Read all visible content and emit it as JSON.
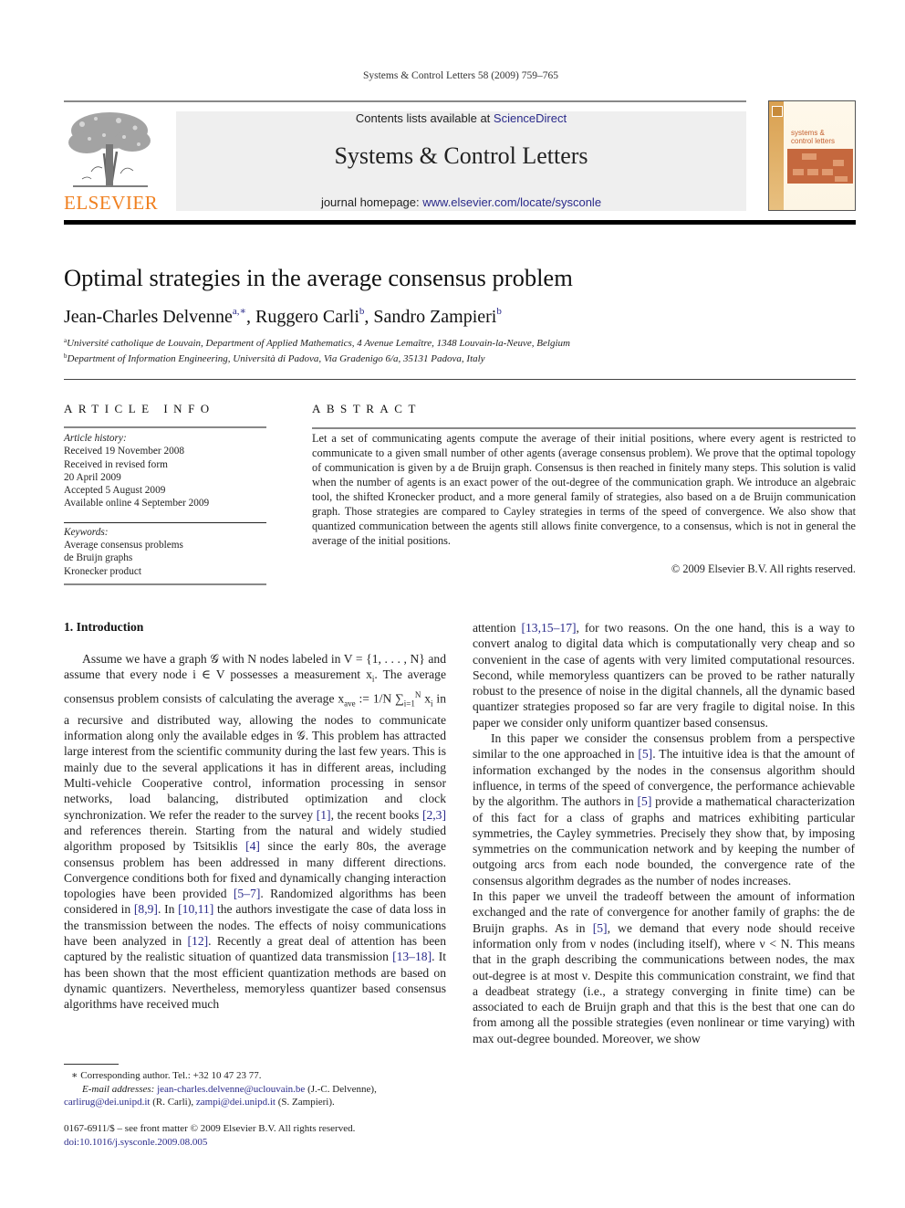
{
  "header": {
    "journal_reference": "Systems & Control Letters 58 (2009) 759–765",
    "publisher_logo_text": "ELSEVIER",
    "contents_prefix": "Contents lists available at ",
    "contents_link": "ScienceDirect",
    "journal_title": "Systems & Control Letters",
    "homepage_prefix": "journal homepage: ",
    "homepage_link": "www.elsevier.com/locate/sysconle",
    "cover_title_line1": "systems &",
    "cover_title_line2": "control letters",
    "colors": {
      "publisher_orange": "#f08020",
      "link_blue": "#2a2a8a",
      "cover_accent": "#c5683e"
    }
  },
  "article": {
    "title": "Optimal strategies in the average consensus problem",
    "authors": [
      {
        "name": "Jean-Charles Delvenne",
        "marks": "a,∗",
        "sep": ", "
      },
      {
        "name": "Ruggero Carli",
        "marks": "b",
        "sep": ", "
      },
      {
        "name": "Sandro Zampieri",
        "marks": "b",
        "sep": ""
      }
    ],
    "affiliations": [
      {
        "mark": "a",
        "text": "Université catholique de Louvain, Department of Applied Mathematics, 4 Avenue Lemaître, 1348 Louvain-la-Neuve, Belgium"
      },
      {
        "mark": "b",
        "text": "Department of Information Engineering, Università di Padova, Via Gradenigo 6/a, 35131 Padova, Italy"
      }
    ]
  },
  "article_info": {
    "heading": "ARTICLE INFO",
    "history_label": "Article history:",
    "history": [
      "Received 19 November 2008",
      "Received in revised form",
      "20 April 2009",
      "Accepted 5 August 2009",
      "Available online 4 September 2009"
    ],
    "keywords_label": "Keywords:",
    "keywords": [
      "Average consensus problems",
      "de Bruijn graphs",
      "Kronecker product"
    ]
  },
  "abstract": {
    "heading": "ABSTRACT",
    "text": "Let a set of communicating agents compute the average of their initial positions, where every agent is restricted to communicate to a given small number of other agents (average consensus problem). We prove that the optimal topology of communication is given by a de Bruijn graph. Consensus is then reached in finitely many steps. This solution is valid when the number of agents is an exact power of the out-degree of the communication graph. We introduce an algebraic tool, the shifted Kronecker product, and a more general family of strategies, also based on a de Bruijn communication graph. Those strategies are compared to Cayley strategies in terms of the speed of convergence. We also show that quantized communication between the agents still allows finite convergence, to a consensus, which is not in general the average of the initial positions.",
    "copyright": "© 2009 Elsevier B.V. All rights reserved."
  },
  "body": {
    "section_title": "1. Introduction",
    "left_paragraph": [
      {
        "t": "Assume we have a graph 𝒢 with N nodes labeled in V = {1, . . . , N} and assume that every node i ∈ V possesses a measurement x"
      },
      {
        "t": "i",
        "sub": true
      },
      {
        "t": ". The average consensus problem consists of calculating the average x"
      },
      {
        "t": "ave",
        "sub": true
      },
      {
        "t": " := 1/N ∑"
      },
      {
        "t": "i=1",
        "sub": true
      },
      {
        "t": "N",
        "sup": true
      },
      {
        "t": " x"
      },
      {
        "t": "i",
        "sub": true
      },
      {
        "t": " in a recursive and distributed way, allowing the nodes to communicate information along only the available edges in 𝒢. This problem has attracted large interest from the scientific community during the last few years. This is mainly due to the several applications it has in different areas, including Multi-vehicle Cooperative control, information processing in sensor networks, load balancing, distributed optimization and clock synchronization. We refer the reader to the survey "
      },
      {
        "t": "[1]",
        "link": true
      },
      {
        "t": ", the recent books "
      },
      {
        "t": "[2,3]",
        "link": true
      },
      {
        "t": " and references therein. Starting from the natural and widely studied algorithm proposed by Tsitsiklis "
      },
      {
        "t": "[4]",
        "link": true
      },
      {
        "t": " since the early 80s, the average consensus problem has been addressed in many different directions. Convergence conditions both for fixed and dynamically changing interaction topologies have been provided "
      },
      {
        "t": "[5–7]",
        "link": true
      },
      {
        "t": ". Randomized algorithms has been considered in "
      },
      {
        "t": "[8,9]",
        "link": true
      },
      {
        "t": ". In "
      },
      {
        "t": "[10,11]",
        "link": true
      },
      {
        "t": " the authors investigate the case of data loss in the transmission between the nodes. The effects of noisy communications have been analyzed in "
      },
      {
        "t": "[12]",
        "link": true
      },
      {
        "t": ". Recently a great deal of attention has been captured by the realistic situation of quantized data transmission "
      },
      {
        "t": "[13–18]",
        "link": true
      },
      {
        "t": ". It has been shown that the most efficient quantization methods are based on dynamic quantizers. Nevertheless, memoryless quantizer based consensus algorithms have received much"
      }
    ],
    "right_paragraphs": [
      {
        "indent": false,
        "parts": [
          {
            "t": "attention "
          },
          {
            "t": "[13,15–17]",
            "link": true
          },
          {
            "t": ", for two reasons. On the one hand, this is a way to convert analog to digital data which is computationally very cheap and so convenient in the case of agents with very limited computational resources. Second, while memoryless quantizers can be proved to be rather naturally robust to the presence of noise in the digital channels, all the dynamic based quantizer strategies proposed so far are very fragile to digital noise. In this paper we consider only uniform quantizer based consensus."
          }
        ]
      },
      {
        "indent": true,
        "parts": [
          {
            "t": "In this paper we consider the consensus problem from a perspective similar to the one approached in "
          },
          {
            "t": "[5]",
            "link": true
          },
          {
            "t": ". The intuitive idea is that the amount of information exchanged by the nodes in the consensus algorithm should influence, in terms of the speed of convergence, the performance achievable by the algorithm. The authors in "
          },
          {
            "t": "[5]",
            "link": true
          },
          {
            "t": " provide a mathematical characterization of this fact for a class of graphs and matrices exhibiting particular symmetries, the Cayley symmetries. Precisely they show that, by imposing symmetries on the communication network and by keeping the number of outgoing arcs from each node bounded, the convergence rate of the consensus algorithm degrades as the number of nodes increases."
          }
        ]
      },
      {
        "indent": false,
        "parts": [
          {
            "t": "In this paper we unveil the tradeoff between the amount of information exchanged and the rate of convergence for another family of graphs: the de Bruijn graphs. As in "
          },
          {
            "t": "[5]",
            "link": true
          },
          {
            "t": ", we demand that every node should receive information only from ν nodes (including itself), where ν < N. This means that in the graph describing the communications between nodes, the max out-degree is at most ν. Despite this communication constraint, we find that a deadbeat strategy (i.e., a strategy converging in finite time) can be associated to each de Bruijn graph and that this is the best that one can do from among all the possible strategies (even nonlinear or time varying) with max out-degree bounded. Moreover, we show"
          }
        ]
      }
    ]
  },
  "footnotes": {
    "star_mark": "∗",
    "corresponding": "Corresponding author. Tel.: +32 10 47 23 77.",
    "email_label": "E-mail addresses:",
    "emails": [
      {
        "addr": "jean-charles.delvenne@uclouvain.be",
        "who": " (J.-C. Delvenne),",
        "sep": " "
      },
      {
        "addr": "carlirug@dei.unipd.it",
        "who": " (R. Carli), ",
        "sep": ""
      },
      {
        "addr": "zampi@dei.unipd.it",
        "who": " (S. Zampieri).",
        "sep": ""
      }
    ],
    "front_matter": "0167-6911/$ – see front matter © 2009 Elsevier B.V. All rights reserved.",
    "doi": "doi:10.1016/j.sysconle.2009.08.005"
  }
}
